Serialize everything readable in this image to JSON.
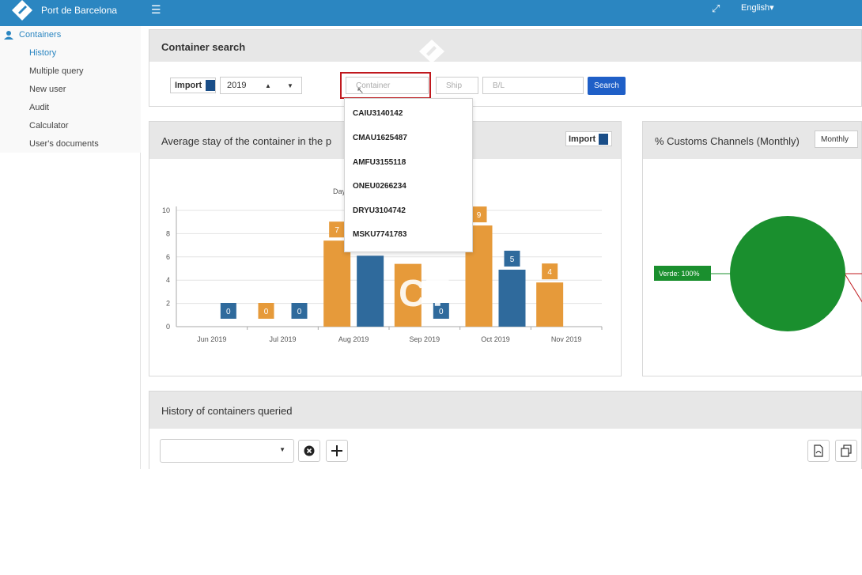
{
  "header": {
    "brand": "Port de Barcelona",
    "language": "English▾"
  },
  "sidebar": {
    "section": "Containers",
    "items": [
      {
        "label": "History",
        "active": true
      },
      {
        "label": "Multiple query"
      },
      {
        "label": "New user"
      },
      {
        "label": "Audit"
      },
      {
        "label": "Calculator"
      },
      {
        "label": "User's documents"
      }
    ]
  },
  "search_panel": {
    "title": "Container search",
    "import_label": "Import",
    "year": "2019",
    "container_placeholder": "Container",
    "ship_placeholder": "Ship",
    "bl_placeholder": "B/L",
    "search_button": "Search",
    "suggestions": [
      "CAIU3140142",
      "CMAU1625487",
      "AMFU3155118",
      "ONEU0266234",
      "DRYU3104742",
      "MSKU7741783"
    ]
  },
  "stay_panel": {
    "title": "Average stay of the container in the p",
    "import_label": "Import",
    "subtitle": "Day",
    "overlay_text": "CT"
  },
  "customs_panel": {
    "title": "% Customs Channels (Monthly)",
    "period_button": "Monthly",
    "slice_label": "Verde: 100%"
  },
  "history_panel": {
    "title": "History of containers queried"
  },
  "colors": {
    "topbar": "#2b86c1",
    "orange": "#e69a3a",
    "blue": "#2f6a9c",
    "green": "#1a8f2e",
    "red_highlight": "#c0191e"
  },
  "chart_data": {
    "type": "bar",
    "categories": [
      "Jun 2019",
      "Jul 2019",
      "Aug 2019",
      "Sep 2019",
      "Oct 2019",
      "Nov 2019"
    ],
    "series": [
      {
        "color": "#e69a3a",
        "values": [
          0,
          0,
          7.4,
          5.4,
          8.7,
          3.8
        ],
        "labels": [
          "",
          "0",
          "7",
          "",
          "9",
          "4"
        ]
      },
      {
        "color": "#2f6a9c",
        "values": [
          0,
          0,
          6.1,
          0,
          4.9,
          null
        ],
        "labels": [
          "0",
          "0",
          "",
          "0",
          "5",
          ""
        ]
      }
    ],
    "ylim": [
      0,
      10
    ],
    "yticks": [
      0,
      2,
      4,
      6,
      8,
      10
    ],
    "grid": true
  },
  "pie_data": {
    "type": "pie",
    "slices": [
      {
        "label": "Verde",
        "value": 100,
        "color": "#1a8f2e"
      }
    ]
  }
}
